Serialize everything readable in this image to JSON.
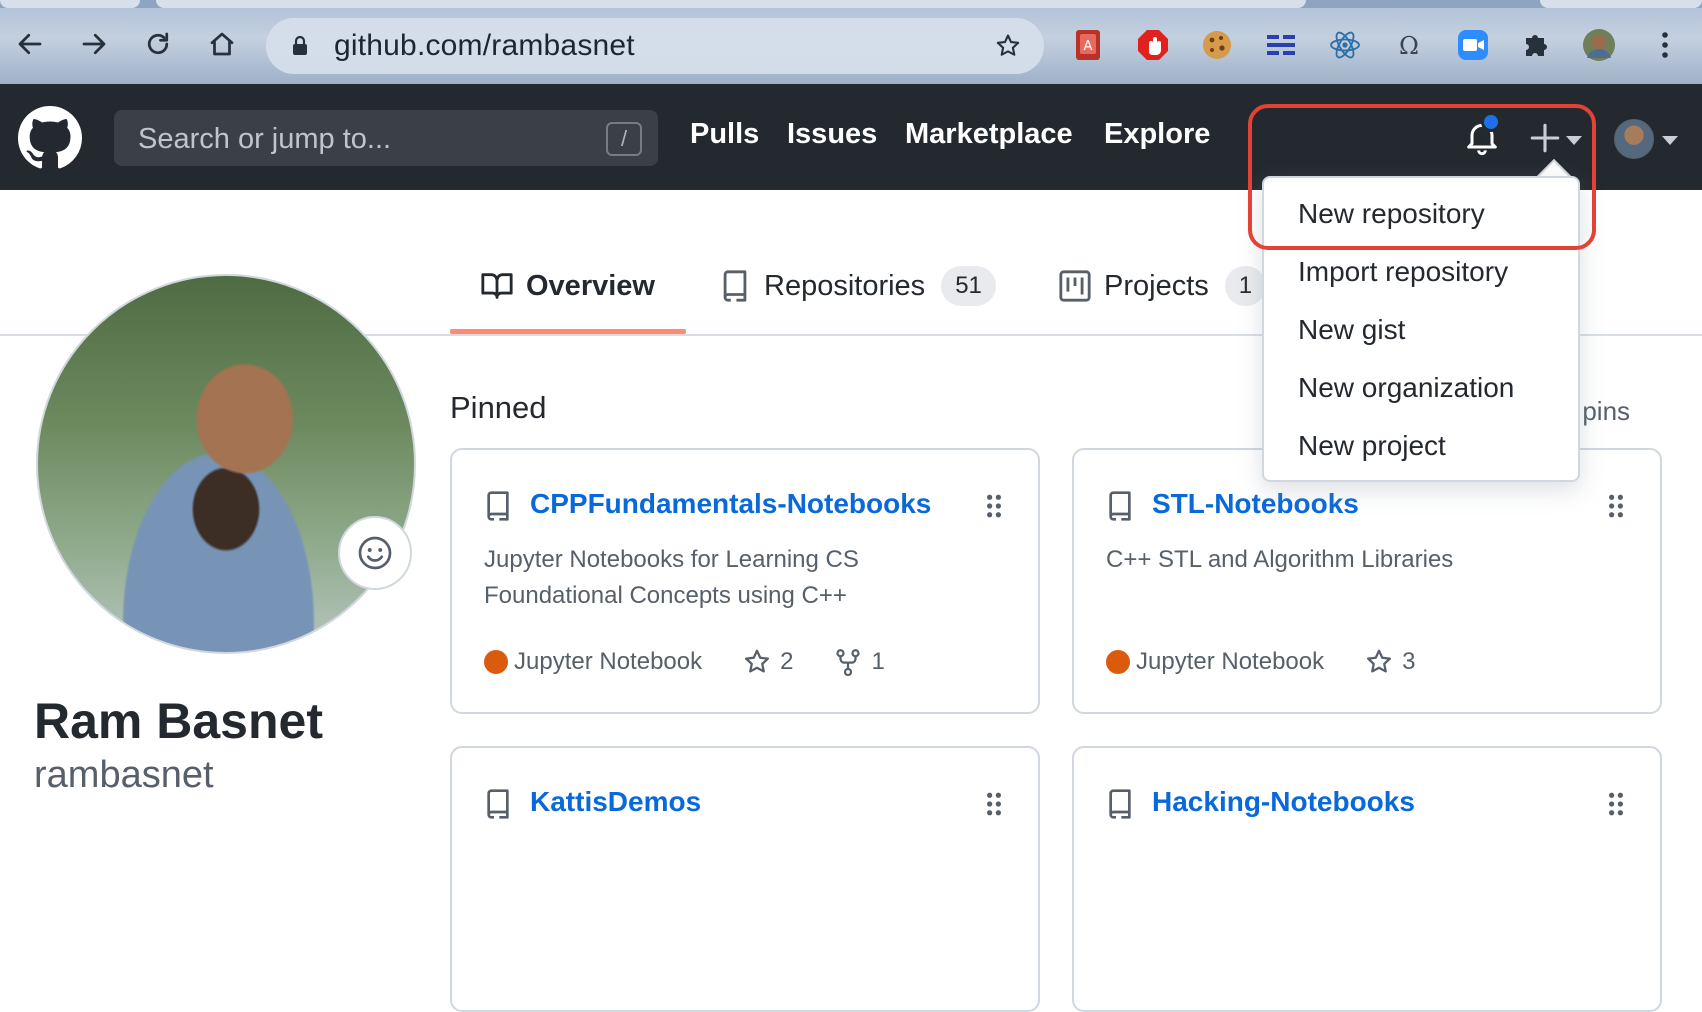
{
  "browser": {
    "url": "github.com/rambasnet"
  },
  "header": {
    "search_placeholder": "Search or jump to...",
    "search_shortcut": "/",
    "nav": [
      "Pulls",
      "Issues",
      "Marketplace",
      "Explore"
    ]
  },
  "create_menu": {
    "items": [
      "New repository",
      "Import repository",
      "New gist",
      "New organization",
      "New project"
    ],
    "highlighted": "New repository",
    "highlight_color": "#e34234"
  },
  "tabs": {
    "overview": "Overview",
    "repositories": "Repositories",
    "repositories_count": "51",
    "projects": "Projects",
    "projects_count": "1"
  },
  "profile": {
    "name": "Ram Basnet",
    "login": "rambasnet"
  },
  "pinned": {
    "title": "Pinned",
    "customize_fragment": "ur pins",
    "repos": [
      {
        "name": "CPPFundamentals-Notebooks",
        "description": "Jupyter Notebooks for Learning CS Foundational Concepts using C++",
        "language": "Jupyter Notebook",
        "stars": "2",
        "forks": "1"
      },
      {
        "name": "STL-Notebooks",
        "description": "C++ STL and Algorithm Libraries",
        "language": "Jupyter Notebook",
        "stars": "3"
      },
      {
        "name": "KattisDemos"
      },
      {
        "name": "Hacking-Notebooks"
      }
    ]
  },
  "colors": {
    "header_bg": "#24292f",
    "link": "#0969da",
    "jupyter": "#da5b0b",
    "active_tab": "#fd8c73",
    "notification_dot": "#1f6feb"
  }
}
